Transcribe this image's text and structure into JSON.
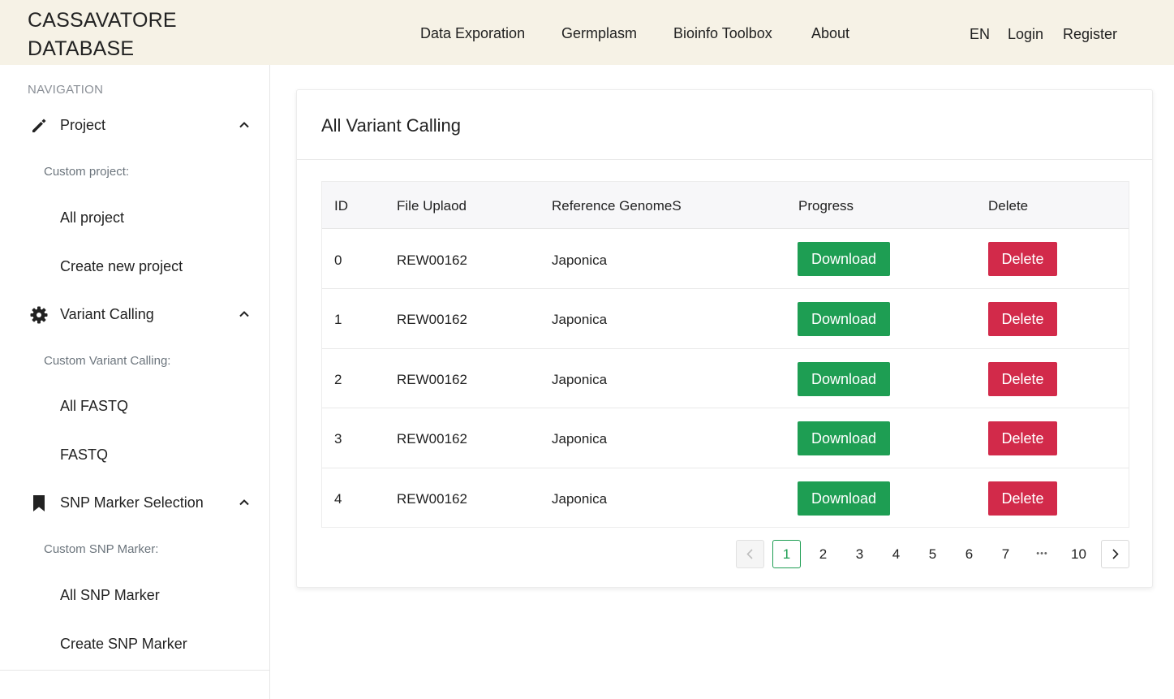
{
  "header": {
    "logo_line1": "CASSAVATORE",
    "logo_line2": "DATABASE",
    "nav": [
      "Data Exporation",
      "Germplasm",
      "Bioinfo Toolbox",
      "About"
    ],
    "lang": "EN",
    "login": "Login",
    "register": "Register"
  },
  "sidebar": {
    "heading": "NAVIGATION",
    "groups": [
      {
        "label": "Project",
        "icon": "pencil-icon",
        "subheading": "Custom project:",
        "items": [
          "All project",
          "Create new project"
        ]
      },
      {
        "label": "Variant Calling",
        "icon": "gear-icon",
        "subheading": "Custom Variant Calling:",
        "items": [
          "All FASTQ",
          "FASTQ"
        ]
      },
      {
        "label": "SNP Marker Selection",
        "icon": "bookmark-icon",
        "subheading": "Custom SNP Marker:",
        "items": [
          "All SNP Marker",
          "Create SNP Marker"
        ]
      }
    ]
  },
  "card": {
    "title": "All Variant Calling"
  },
  "table": {
    "columns": [
      "ID",
      "File Uplaod",
      "Reference GenomeS",
      "Progress",
      "Delete"
    ],
    "rows": [
      {
        "id": "0",
        "file": "REW00162",
        "genome": "Japonica",
        "progress": "Download",
        "delete": "Delete"
      },
      {
        "id": "1",
        "file": "REW00162",
        "genome": "Japonica",
        "progress": "Download",
        "delete": "Delete"
      },
      {
        "id": "2",
        "file": "REW00162",
        "genome": "Japonica",
        "progress": "Download",
        "delete": "Delete"
      },
      {
        "id": "3",
        "file": "REW00162",
        "genome": "Japonica",
        "progress": "Download",
        "delete": "Delete"
      },
      {
        "id": "4",
        "file": "REW00162",
        "genome": "Japonica",
        "progress": "Download",
        "delete": "Delete"
      }
    ]
  },
  "pagination": {
    "current": "1",
    "pages": [
      "1",
      "2",
      "3",
      "4",
      "5",
      "6",
      "7",
      "•••",
      "10"
    ],
    "prev_icon": "chevron-left-icon",
    "next_icon": "chevron-right-icon"
  },
  "colors": {
    "header_bg": "#f6f2e6",
    "success": "#1e9e53",
    "danger": "#d22a4a"
  }
}
